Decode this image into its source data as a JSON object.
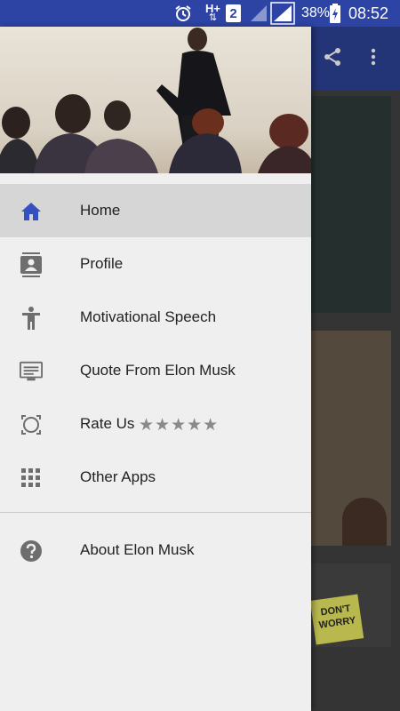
{
  "status_bar": {
    "network": "H+",
    "sim": "2",
    "battery": "38%",
    "time": "08:52"
  },
  "colors": {
    "status_bar": "#2d44a5",
    "toolbar": "#233477",
    "active_icon": "#3551c0",
    "drawer_bg": "#efefef"
  },
  "drawer": {
    "menu": [
      {
        "label": "Home",
        "icon": "home-icon",
        "active": true
      },
      {
        "label": "Profile",
        "icon": "contact-card-icon"
      },
      {
        "label": "Motivational Speech",
        "icon": "accessibility-icon"
      },
      {
        "label": "Quote From Elon Musk",
        "icon": "monitor-icon"
      },
      {
        "label": "Rate Us",
        "icon": "camera-focus-icon",
        "stars": "★★★★★"
      },
      {
        "label": "Other Apps",
        "icon": "apps-grid-icon"
      }
    ],
    "about": {
      "label": "About Elon Musk",
      "icon": "help-circle-icon"
    }
  },
  "background": {
    "note_text": "DON'T WORRY"
  }
}
